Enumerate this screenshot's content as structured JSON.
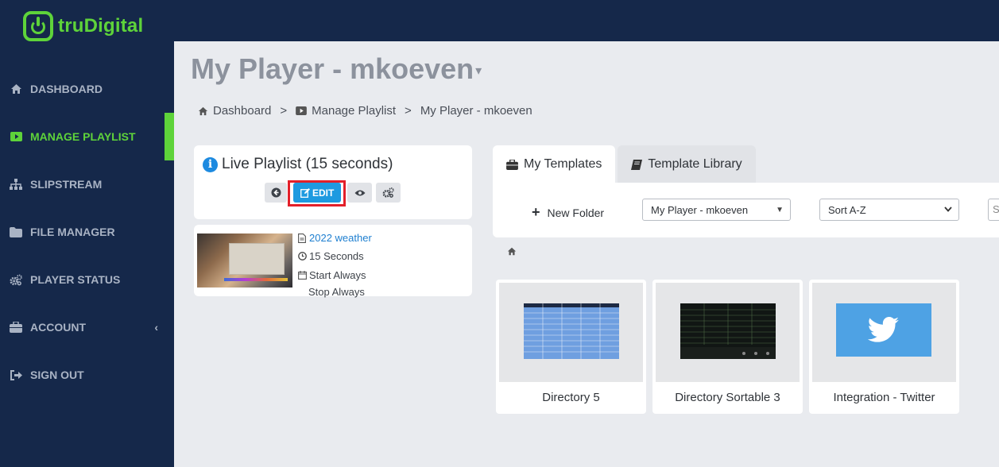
{
  "app": {
    "brand": "truDigital"
  },
  "sidebar": {
    "items": [
      {
        "label": "DASHBOARD",
        "icon": "home-icon"
      },
      {
        "label": "MANAGE PLAYLIST",
        "icon": "play-icon",
        "active": true
      },
      {
        "label": "SLIPSTREAM",
        "icon": "sitemap-icon"
      },
      {
        "label": "FILE MANAGER",
        "icon": "folder-icon"
      },
      {
        "label": "PLAYER STATUS",
        "icon": "cogs-icon"
      },
      {
        "label": "ACCOUNT",
        "icon": "briefcase-icon",
        "chevron": "‹"
      },
      {
        "label": "SIGN OUT",
        "icon": "sign-out-icon"
      }
    ]
  },
  "header": {
    "title": "My Player - mkoeven",
    "caret": "▾"
  },
  "breadcrumb": {
    "items": [
      "Dashboard",
      "Manage Playlist",
      "My Player - mkoeven"
    ],
    "separator": ">"
  },
  "live_playlist": {
    "title": "Live Playlist (15 seconds)",
    "info_symbol": "i",
    "edit_label": "EDIT",
    "item": {
      "name": "2022 weather",
      "duration": "15 Seconds",
      "start": "Start Always",
      "stop": "Stop Always"
    }
  },
  "tabs": [
    {
      "label": "My Templates",
      "icon": "briefcase-icon",
      "active": true
    },
    {
      "label": "Template Library",
      "icon": "book-icon"
    }
  ],
  "toolbar": {
    "new_folder_label": "New Folder",
    "plus": "+",
    "folder_select": "My Player - mkoeven",
    "sort_select": "Sort A-Z",
    "search_stub": "S"
  },
  "templates": [
    {
      "label": "Directory 5"
    },
    {
      "label": "Directory Sortable 3"
    },
    {
      "label": "Integration - Twitter"
    }
  ],
  "colors": {
    "sidebar_bg": "#15284a",
    "accent_green": "#5ed33a",
    "edit_blue": "#1e9ae0",
    "highlight_red": "#e3202a",
    "twitter_blue": "#4ea2e4"
  }
}
